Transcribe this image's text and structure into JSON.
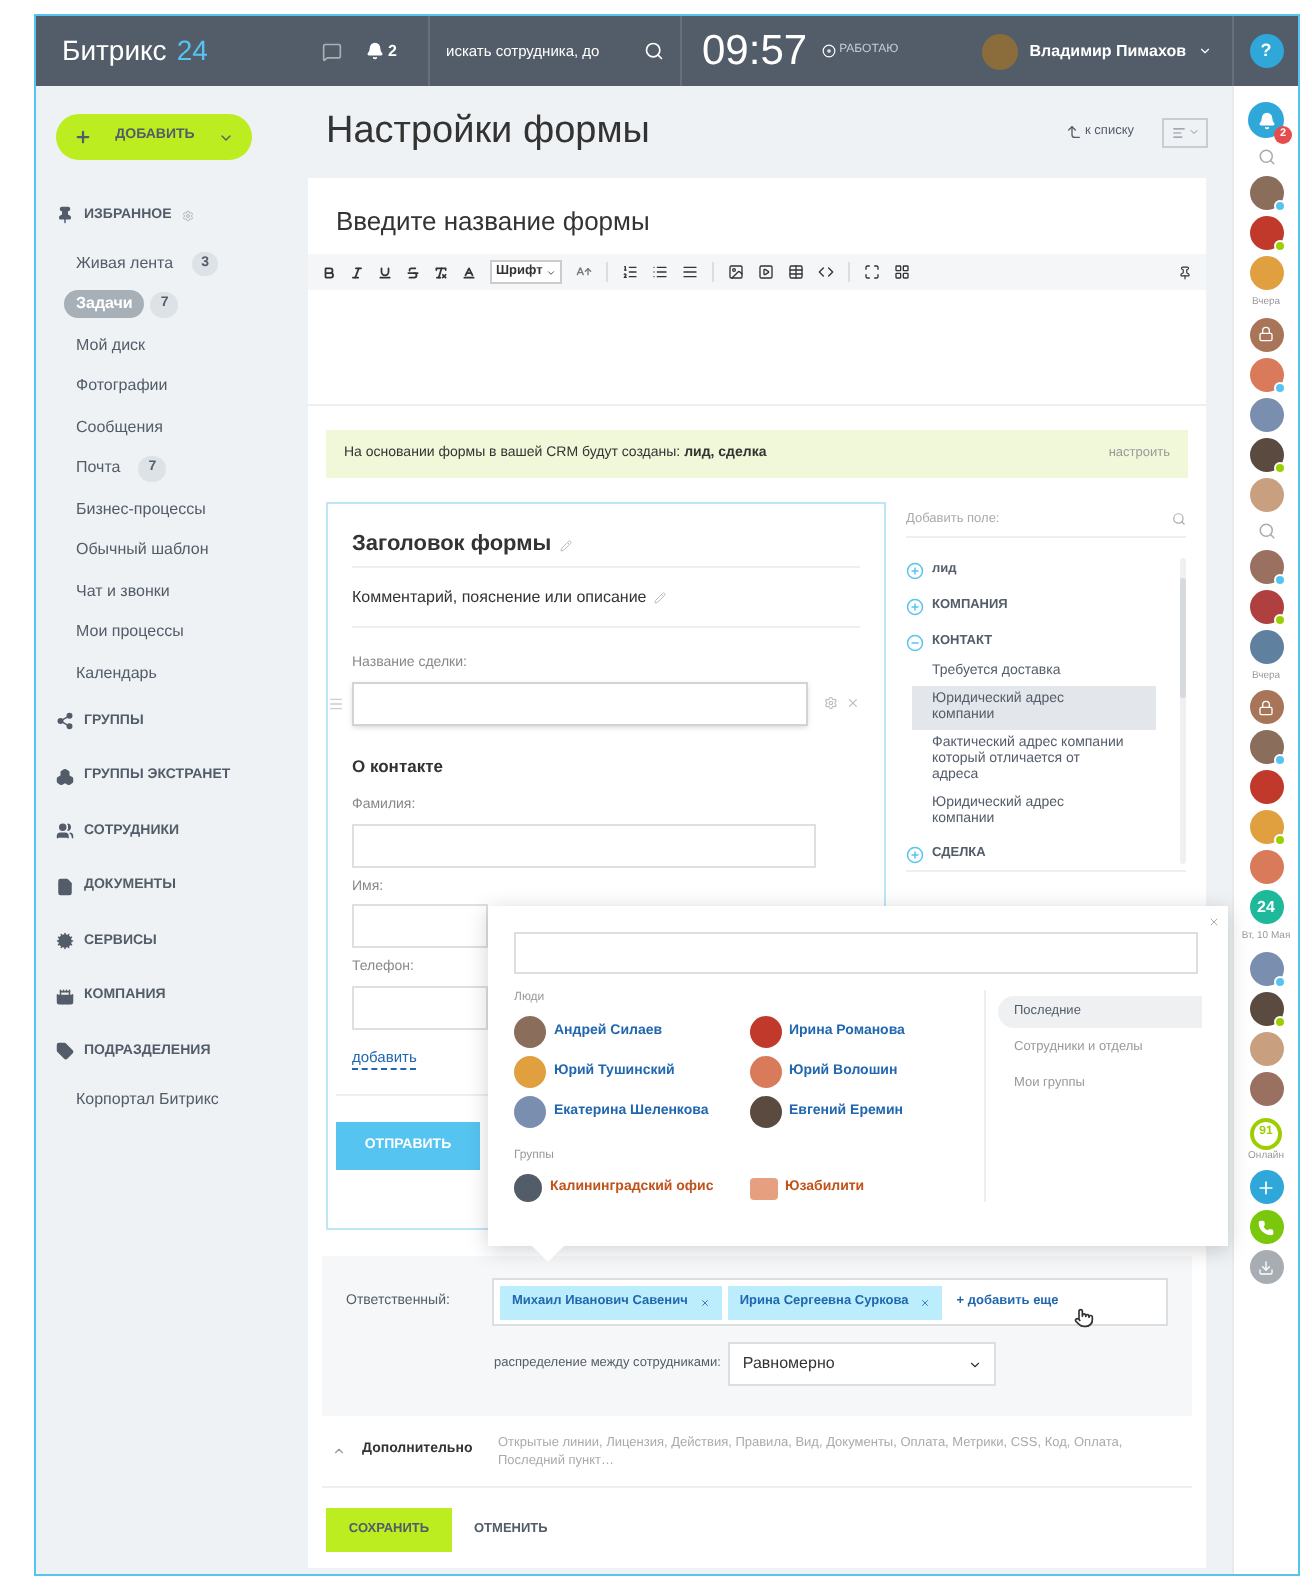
{
  "header": {
    "logo_text": "Битрикс",
    "logo_number": "24",
    "notifications_count": "2",
    "search_placeholder": "искать сотрудника, до",
    "time": "09:57",
    "status": "РАБОТАЮ",
    "user_name": "Владимир Пимахов",
    "help": "?"
  },
  "add_button": {
    "label": "ДОБАВИТЬ"
  },
  "sidebar": {
    "items": [
      {
        "label": "ИЗБРАННОЕ",
        "children": [
          {
            "label": "Живая лента",
            "counter": "3",
            "selected": false
          },
          {
            "label": "Задачи",
            "counter": "7",
            "selected": true
          },
          {
            "label": "Мой диск",
            "selected": false
          },
          {
            "label": "Фотографии",
            "selected": false
          },
          {
            "label": "Сообщения",
            "selected": false
          },
          {
            "label": "Почта",
            "counter": "7",
            "selected": false
          },
          {
            "label": "Бизнес-процессы",
            "selected": false
          },
          {
            "label": "Обычный шаблон",
            "selected": false
          },
          {
            "label": "Чат и звонки",
            "selected": false
          },
          {
            "label": "Мои процессы",
            "selected": false
          },
          {
            "label": "Календарь",
            "selected": false
          }
        ]
      },
      {
        "label": "ГРУППЫ"
      },
      {
        "label": "ГРУППЫ ЭКСТРАНЕТ"
      },
      {
        "label": "СОТРУДНИКИ"
      },
      {
        "label": "ДОКУМЕНТЫ"
      },
      {
        "label": "СЕРВИСЫ"
      },
      {
        "label": "КОМПАНИЯ"
      },
      {
        "label": "ПОДРАЗДЕЛЕНИЯ",
        "children": [
          {
            "label": "Корпортал Битрикс",
            "selected": false
          }
        ]
      }
    ]
  },
  "page": {
    "title": "Настройки формы",
    "back_link": "к списку"
  },
  "form": {
    "name": {
      "placeholder": "Введите название формы"
    },
    "font_select": "Шрифт",
    "notice": {
      "text": "На основании формы в вашей CRM будут созданы: **лид, сделка**",
      "action": "настроить"
    },
    "preview": {
      "title": "Заголовок формы",
      "description": "Комментарий, пояснение или описание",
      "fields": [
        {
          "kind": "input",
          "label": "Название сделки:",
          "hovered": true
        },
        {
          "kind": "section",
          "label": "О контакте"
        },
        {
          "kind": "input",
          "label": "Фамилия:",
          "hovered": false
        },
        {
          "kind": "input",
          "label": "Имя:",
          "hovered": false
        },
        {
          "kind": "input",
          "label": "Телефон:",
          "hovered": false
        }
      ],
      "add_link": "добавить",
      "submit": "ОТПРАВИТЬ"
    },
    "field_list": {
      "search": {
        "placeholder": "Добавить поле:"
      },
      "sections": [
        {
          "label": "лид",
          "expanded": false
        },
        {
          "label": "КОМПАНИЯ",
          "expanded": false
        },
        {
          "label": "КОНТАКТ",
          "expanded": true,
          "children": [
            {
              "label": "Требуется доставка",
              "selected": false
            },
            {
              "label": "Юридический адрес компании",
              "selected": true
            },
            {
              "label": "Фактический адрес компании который отличается от адреса",
              "selected": false
            },
            {
              "label": "Юридический адрес компании",
              "selected": false
            }
          ]
        },
        {
          "label": "СДЕЛКА",
          "expanded": false
        }
      ]
    },
    "popup": {
      "people_heading": "Люди",
      "people": [
        {
          "name": "Андрей Силаев"
        },
        {
          "name": "Ирина Романова"
        },
        {
          "name": "Юрий Тушинский"
        },
        {
          "name": "Юрий Волошин"
        },
        {
          "name": "Екатерина Шеленкова"
        },
        {
          "name": "Евгений Еремин"
        }
      ],
      "groups_heading": "Группы",
      "groups": [
        {
          "name": "Калининградский офис"
        },
        {
          "name": "Юзабилити"
        }
      ],
      "tabs": [
        {
          "label": "Последние",
          "selected": true
        },
        {
          "label": "Сотрудники и отделы",
          "selected": false
        },
        {
          "label": "Мои группы",
          "selected": false
        }
      ]
    },
    "responsible": {
      "label": "Ответственный:",
      "tags": [
        "Михаил Иванович Савенич",
        "Ирина Сергеевна Суркова"
      ],
      "add_more": "+ добавить еще",
      "distribution_label": "распределение между сотрудниками:",
      "distribution_value": "Равномерно"
    },
    "more": {
      "label": "Дополнительно",
      "summary": "Открытые линии, Лицензия, Действия, Правила, Вид, Документы, Оплата, Метрики, CSS, Код, Оплата, Последний пункт…"
    },
    "buttons": {
      "save": "СОХРАНИТЬ",
      "cancel": "ОТМЕНИТЬ"
    }
  },
  "right_bar": {
    "notifications_count": "2",
    "items": [
      {
        "kind": "search"
      },
      {
        "kind": "avatar",
        "color": "#55c4f0"
      },
      {
        "kind": "avatar",
        "color": "#9dcf00"
      },
      {
        "kind": "avatar"
      },
      {
        "kind": "label",
        "text": "Вчера"
      },
      {
        "kind": "lock"
      },
      {
        "kind": "avatar",
        "color": "#55c4f0"
      },
      {
        "kind": "avatar"
      },
      {
        "kind": "avatar",
        "color": "#9dcf00"
      },
      {
        "kind": "avatar"
      },
      {
        "kind": "search"
      },
      {
        "kind": "avatar",
        "color": "#55c4f0"
      },
      {
        "kind": "avatar",
        "color": "#9dcf00"
      },
      {
        "kind": "avatar"
      },
      {
        "kind": "label",
        "text": "Вчера"
      },
      {
        "kind": "lock"
      },
      {
        "kind": "avatar",
        "color": "#55c4f0"
      },
      {
        "kind": "avatar"
      },
      {
        "kind": "avatar",
        "color": "#9dcf00"
      },
      {
        "kind": "avatar"
      },
      {
        "kind": "number",
        "text": "24"
      },
      {
        "kind": "label",
        "text": "Вт, 10 Мая"
      },
      {
        "kind": "avatar",
        "color": "#55c4f0"
      },
      {
        "kind": "avatar",
        "color": "#9dcf00"
      },
      {
        "kind": "avatar"
      },
      {
        "kind": "avatar"
      },
      {
        "kind": "online",
        "text": "91",
        "caption": "Онлайн"
      },
      {
        "kind": "add"
      },
      {
        "kind": "phone"
      },
      {
        "kind": "download"
      }
    ]
  }
}
